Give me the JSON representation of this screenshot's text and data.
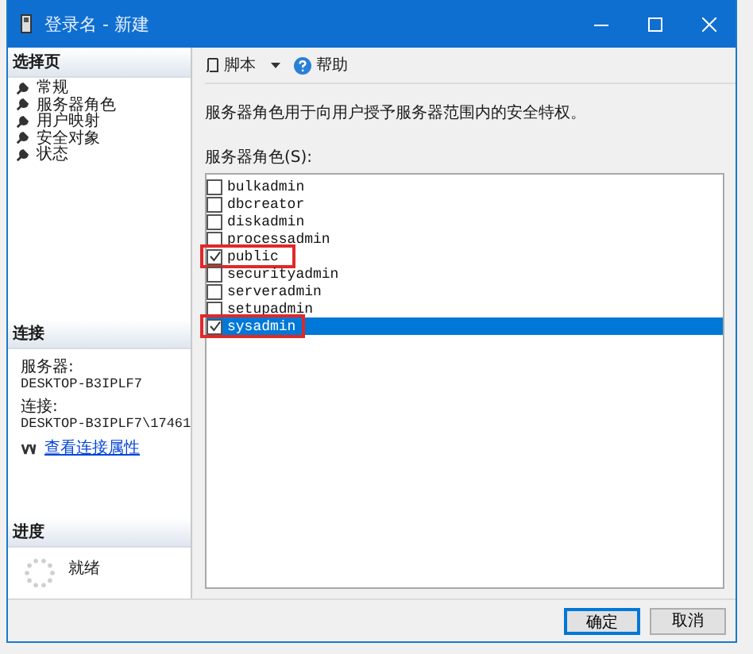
{
  "window": {
    "title": "登录名 - 新建"
  },
  "sidebar": {
    "header": "选择页",
    "items": [
      {
        "label": "常规"
      },
      {
        "label": "服务器角色"
      },
      {
        "label": "用户映射"
      },
      {
        "label": "安全对象"
      },
      {
        "label": "状态"
      }
    ]
  },
  "connection": {
    "header": "连接",
    "server_label": "服务器:",
    "server": "DESKTOP-B3IPLF7",
    "connection_label": "连接:",
    "connection": "DESKTOP-B3IPLF7\\17461",
    "link": "查看连接属性"
  },
  "progress": {
    "header": "进度",
    "status": "就绪"
  },
  "toolbar": {
    "script": "脚本",
    "help": "帮助"
  },
  "description": "服务器角色用于向用户授予服务器范围内的安全特权。",
  "roles_label": "服务器角色(S):",
  "roles": [
    {
      "name": "bulkadmin",
      "checked": false,
      "selected": false,
      "highlighted": false
    },
    {
      "name": "dbcreator",
      "checked": false,
      "selected": false,
      "highlighted": false
    },
    {
      "name": "diskadmin",
      "checked": false,
      "selected": false,
      "highlighted": false
    },
    {
      "name": "processadmin",
      "checked": false,
      "selected": false,
      "highlighted": false
    },
    {
      "name": "public",
      "checked": true,
      "selected": false,
      "highlighted": true
    },
    {
      "name": "securityadmin",
      "checked": false,
      "selected": false,
      "highlighted": false
    },
    {
      "name": "serveradmin",
      "checked": false,
      "selected": false,
      "highlighted": false
    },
    {
      "name": "setupadmin",
      "checked": false,
      "selected": false,
      "highlighted": false
    },
    {
      "name": "sysadmin",
      "checked": true,
      "selected": true,
      "highlighted": true
    }
  ],
  "buttons": [
    {
      "label": "确定",
      "default": true
    },
    {
      "label": "取消",
      "default": false
    }
  ]
}
